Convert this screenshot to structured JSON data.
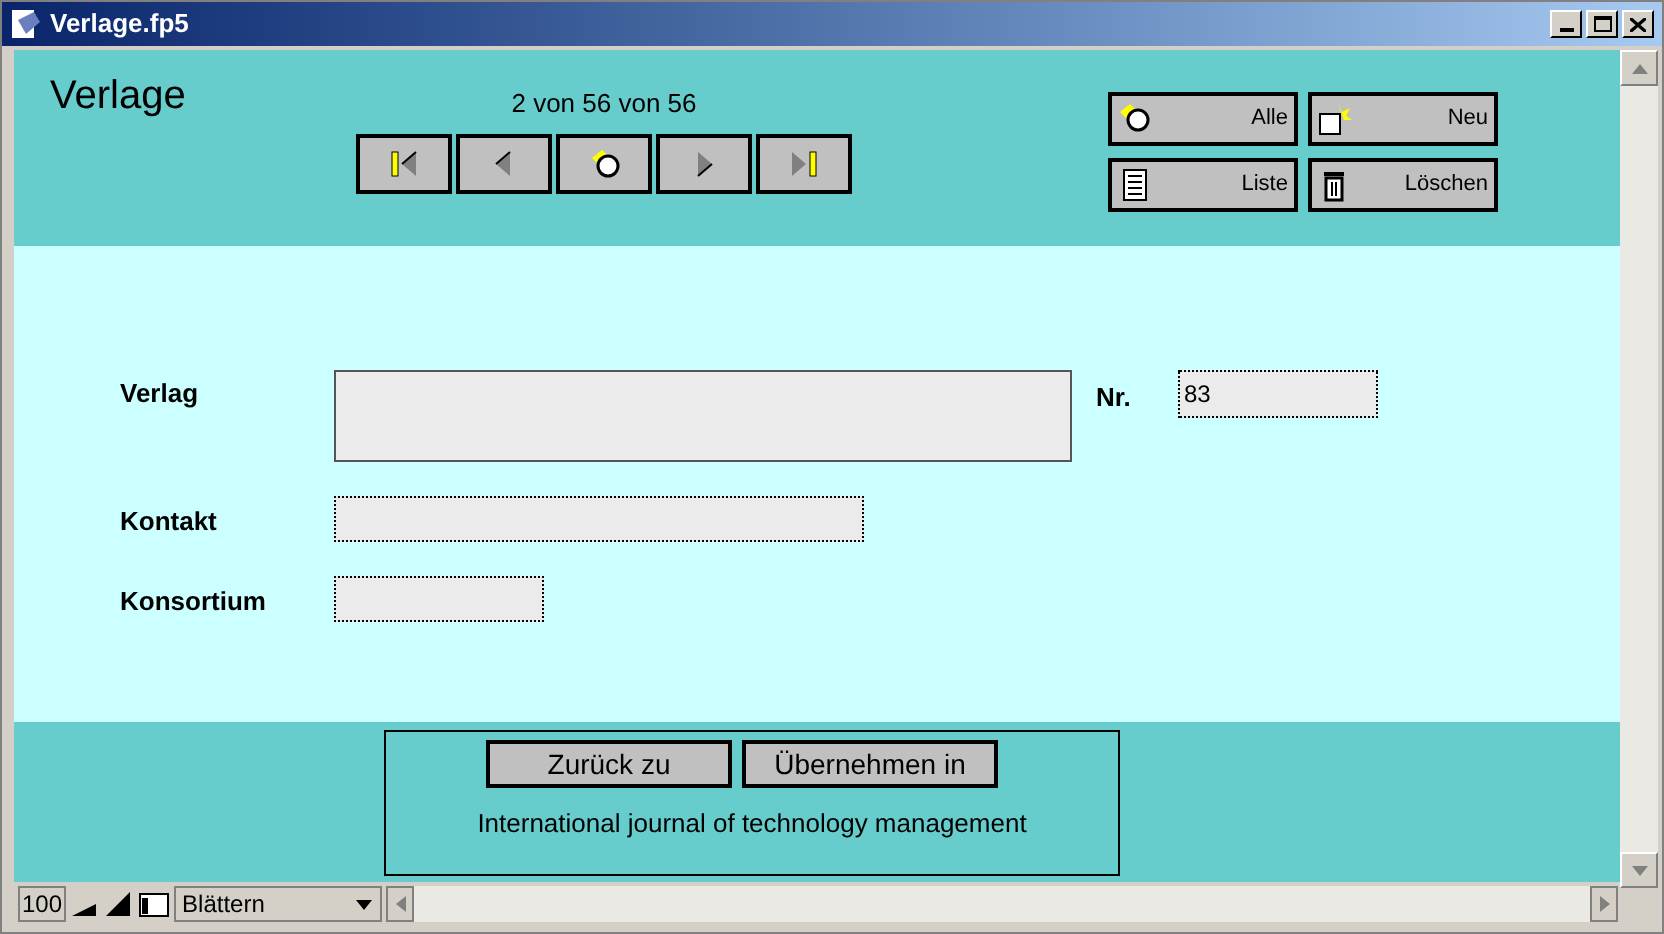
{
  "window": {
    "title": "Verlage.fp5"
  },
  "header": {
    "title": "Verlage",
    "record_counter": "2 von 56 von 56"
  },
  "nav_buttons": [
    {
      "kind": "first"
    },
    {
      "kind": "prev"
    },
    {
      "kind": "find"
    },
    {
      "kind": "next"
    },
    {
      "kind": "last"
    }
  ],
  "action_buttons": [
    {
      "label": "Alle",
      "kind": "find"
    },
    {
      "label": "Neu",
      "kind": "new"
    },
    {
      "label": "Liste",
      "kind": "list"
    },
    {
      "label": "Löschen",
      "kind": "delete"
    }
  ],
  "fields": [
    {
      "label": "Verlag",
      "kind": "large"
    },
    {
      "label": "Nr.",
      "value": "83",
      "kind": "small"
    },
    {
      "label": "Kontakt",
      "kind": "medium"
    },
    {
      "label": "Konsortium",
      "kind": "short"
    }
  ],
  "footer": {
    "buttons": [
      "Zurück zu",
      "Übernehmen in"
    ],
    "text": "International journal of technology management"
  },
  "status_bar": {
    "zoom": "100",
    "mode": "Blättern"
  }
}
